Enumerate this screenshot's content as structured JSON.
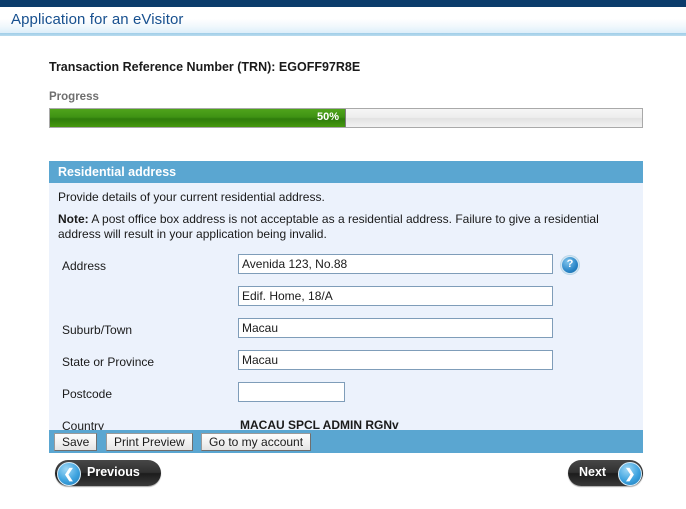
{
  "header": {
    "title": "Application for an eVisitor"
  },
  "trn": {
    "text": "Transaction Reference Number (TRN): EGOFF97R8E"
  },
  "progress": {
    "label": "Progress",
    "value_text": "50%",
    "percent": 50
  },
  "panel": {
    "title": "Residential address",
    "intro": "Provide details of your current residential address.",
    "note_prefix": "Note:",
    "note_body": " A post office box address is not acceptable as a residential address. Failure to give a residential address will result in your application being invalid.",
    "fields": [
      {
        "label": "Address",
        "value": "Avenida 123, No.88",
        "placeholder": ""
      },
      {
        "label": "",
        "value": "Edif. Home, 18/A",
        "placeholder": ""
      },
      {
        "label": "Suburb/Town",
        "value": "Macau",
        "placeholder": ""
      },
      {
        "label": "State or Province",
        "value": "Macau",
        "placeholder": ""
      },
      {
        "label": "Postcode",
        "value": "",
        "placeholder": ""
      },
      {
        "label": "Country",
        "value": "MACAU SPCL ADMIN RGNv",
        "placeholder": ""
      }
    ],
    "help_icon": "question-mark"
  },
  "action_bar": {
    "save": "Save",
    "print_preview": "Print Preview",
    "go_to_account": "Go to my account"
  },
  "navigation": {
    "previous": "Previous",
    "previous_icon": "❮",
    "next": "Next",
    "next_icon": "❯"
  },
  "colors": {
    "header_strip": "#0b3c6b",
    "title_text": "#17508f",
    "panel_header": "#5aa6d1",
    "panel_body": "#ecf2fc",
    "progress_fill": "#3f9214",
    "action_bar": "#5aa6d1"
  }
}
